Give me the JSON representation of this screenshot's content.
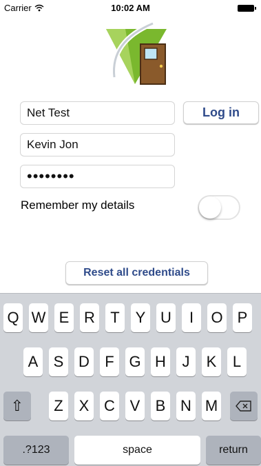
{
  "status_bar": {
    "carrier": "Carrier",
    "time": "10:02 AM"
  },
  "form": {
    "domain_value": "Net Test",
    "username_value": "Kevin Jon",
    "password_value": "••••••••",
    "login_label": "Log in",
    "remember_label": "Remember my details",
    "remember_enabled": false,
    "reset_label": "Reset all credentials"
  },
  "icons": [
    "wifi-icon",
    "battery-icon",
    "app-logo-icon",
    "door-icon",
    "shift-icon",
    "delete-icon"
  ],
  "colors": {
    "button_text": "#2f4b8a",
    "logo_green": "#7ab82e",
    "door_brown": "#8a5a2b",
    "keyboard_bg": "#d1d4d9"
  },
  "keyboard": {
    "row1": [
      "Q",
      "W",
      "E",
      "R",
      "T",
      "Y",
      "U",
      "I",
      "O",
      "P"
    ],
    "row2": [
      "A",
      "S",
      "D",
      "F",
      "G",
      "H",
      "J",
      "K",
      "L"
    ],
    "row3": [
      "Z",
      "X",
      "C",
      "V",
      "B",
      "N",
      "M"
    ],
    "shift_label": "⇧",
    "numbers_label": ".?123",
    "space_label": "space",
    "return_label": "return"
  }
}
